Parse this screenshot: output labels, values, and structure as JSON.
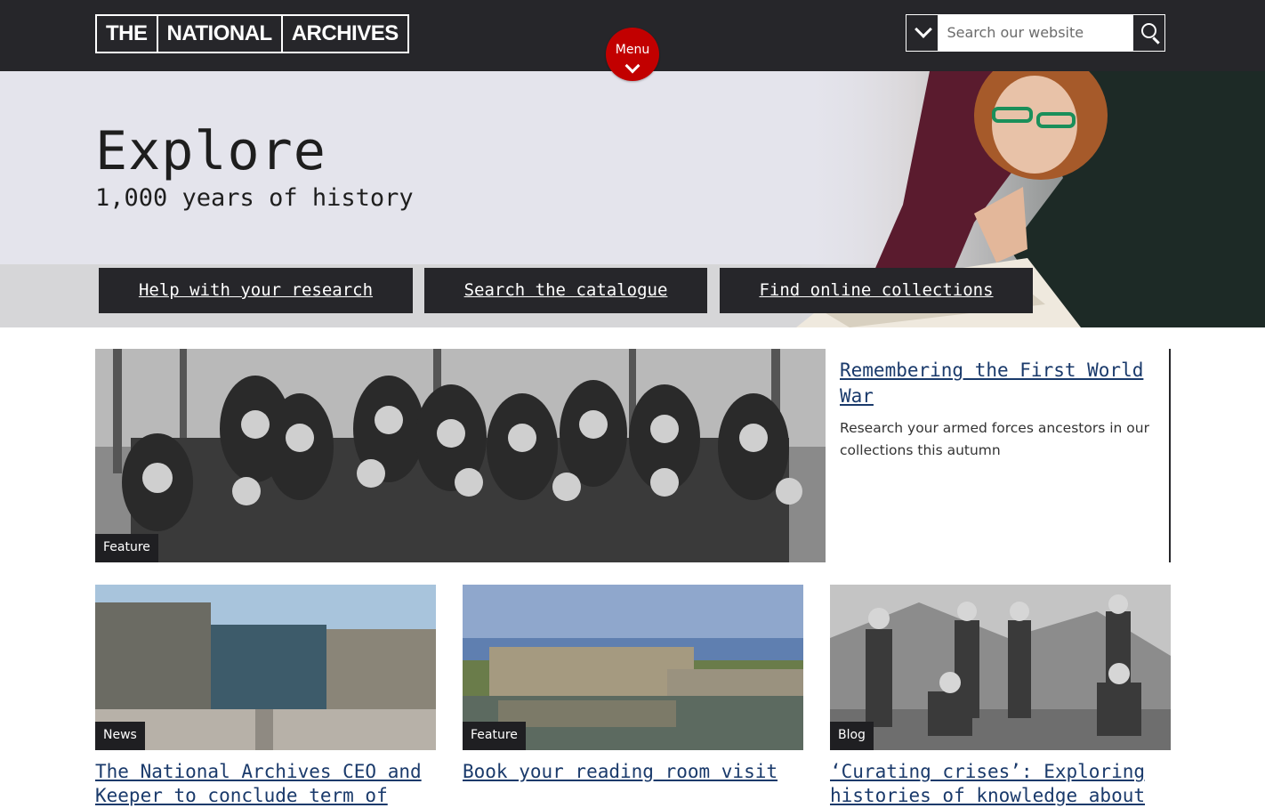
{
  "header": {
    "logo_parts": [
      "THE",
      "NATIONAL",
      "ARCHIVES"
    ],
    "menu_label": "Menu",
    "search_placeholder": "Search our website"
  },
  "hero": {
    "title": "Explore",
    "subtitle": "1,000 years of history",
    "buttons": [
      "Help with your research",
      "Search the catalogue",
      "Find online collections"
    ]
  },
  "feature": {
    "tag": "Feature",
    "title": "Remembering the First World War",
    "description": "Research your armed forces ancestors in our collections this autumn"
  },
  "cards": [
    {
      "tag": "News",
      "title": "The National Archives CEO and Keeper to conclude term of"
    },
    {
      "tag": "Feature",
      "title": "Book your reading room visit"
    },
    {
      "tag": "Blog",
      "title": "‘Curating crises’: Exploring histories of knowledge about"
    }
  ],
  "colors": {
    "header_bg": "#26262a",
    "menu_red": "#c20000",
    "hero_bg": "#e4e4ec",
    "link": "#1a3a6b"
  }
}
